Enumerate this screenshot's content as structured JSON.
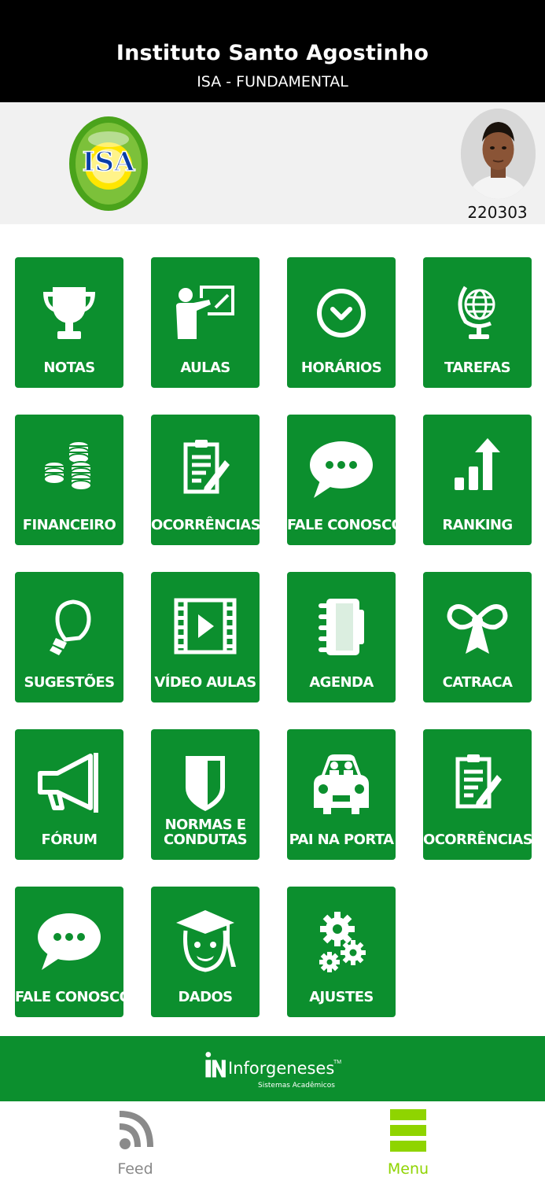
{
  "header": {
    "title": "Instituto Santo Agostinho",
    "subtitle": "ISA - FUNDAMENTAL"
  },
  "profile": {
    "logo_text": "ISA",
    "student_id": "220303"
  },
  "menu": [
    {
      "label": "NOTAS",
      "icon": "trophy-icon"
    },
    {
      "label": "AULAS",
      "icon": "teacher-board-icon"
    },
    {
      "label": "HORÁRIOS",
      "icon": "clock-icon"
    },
    {
      "label": "TAREFAS",
      "icon": "globe-icon"
    },
    {
      "label": "FINANCEIRO",
      "icon": "coins-icon"
    },
    {
      "label": "OCORRÊNCIAS",
      "icon": "clipboard-pen-icon"
    },
    {
      "label": "FALE CONOSCO",
      "icon": "chat-bubble-icon"
    },
    {
      "label": "RANKING",
      "icon": "ranking-bars-icon"
    },
    {
      "label": "SUGESTÕES",
      "icon": "lightbulb-icon"
    },
    {
      "label": "VÍDEO AULAS",
      "icon": "video-film-icon"
    },
    {
      "label": "AGENDA",
      "icon": "agenda-notebook-icon"
    },
    {
      "label": "CATRACA",
      "icon": "ribbon-bow-icon"
    },
    {
      "label": "FÓRUM",
      "icon": "megaphone-icon"
    },
    {
      "label": "NORMAS E CONDUTAS",
      "icon": "shield-icon"
    },
    {
      "label": "PAI NA PORTA",
      "icon": "car-icon"
    },
    {
      "label": "OCORRÊNCIAS",
      "icon": "clipboard-pen-icon"
    },
    {
      "label": "FALE CONOSCO",
      "icon": "chat-bubble-icon"
    },
    {
      "label": "DADOS",
      "icon": "graduate-face-icon"
    },
    {
      "label": "AJUSTES",
      "icon": "gears-icon"
    }
  ],
  "footer": {
    "brand_name": "Inforgeneses",
    "brand_tm": "TM",
    "brand_tagline": "Sistemas Acadêmicos"
  },
  "tabs": [
    {
      "label": "Feed",
      "icon": "rss-feed-icon",
      "color": "#888888"
    },
    {
      "label": "Menu",
      "icon": "menu-lines-icon",
      "color": "#8fd400"
    }
  ],
  "colors": {
    "tile_green": "#0c8f2e",
    "active_tab": "#8fd400"
  }
}
